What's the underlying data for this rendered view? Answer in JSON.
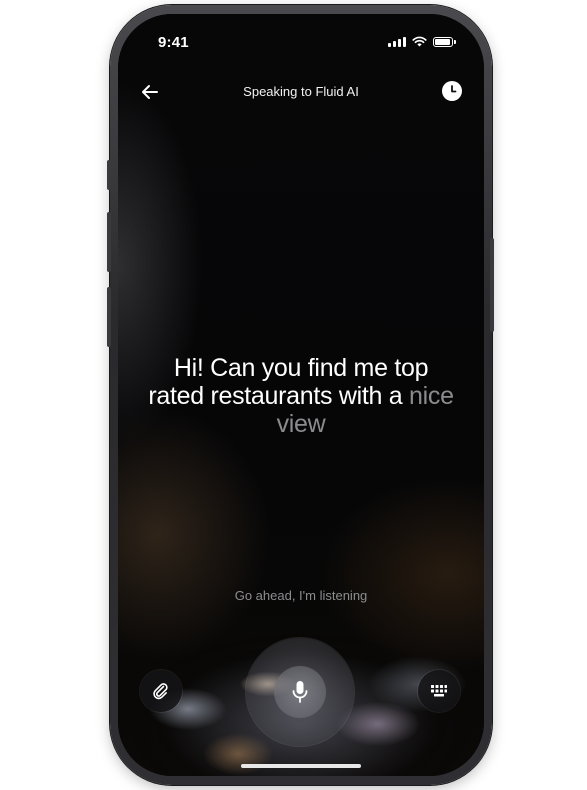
{
  "status_bar": {
    "time": "9:41"
  },
  "header": {
    "title": "Speaking to Fluid AI"
  },
  "transcript": {
    "spoken": "Hi! Can you find me top rated restaurants with a",
    "pending": "nice view"
  },
  "hint": {
    "text": "Go ahead, I'm listening"
  },
  "controls": {
    "attach_icon": "paperclip-icon",
    "mic_icon": "microphone-icon",
    "keyboard_icon": "keyboard-icon",
    "back_icon": "arrow-left-icon",
    "history_icon": "clock-icon"
  },
  "colors": {
    "background": "#050506",
    "text_primary": "#ffffff",
    "text_faded": "#8b8b8e"
  }
}
